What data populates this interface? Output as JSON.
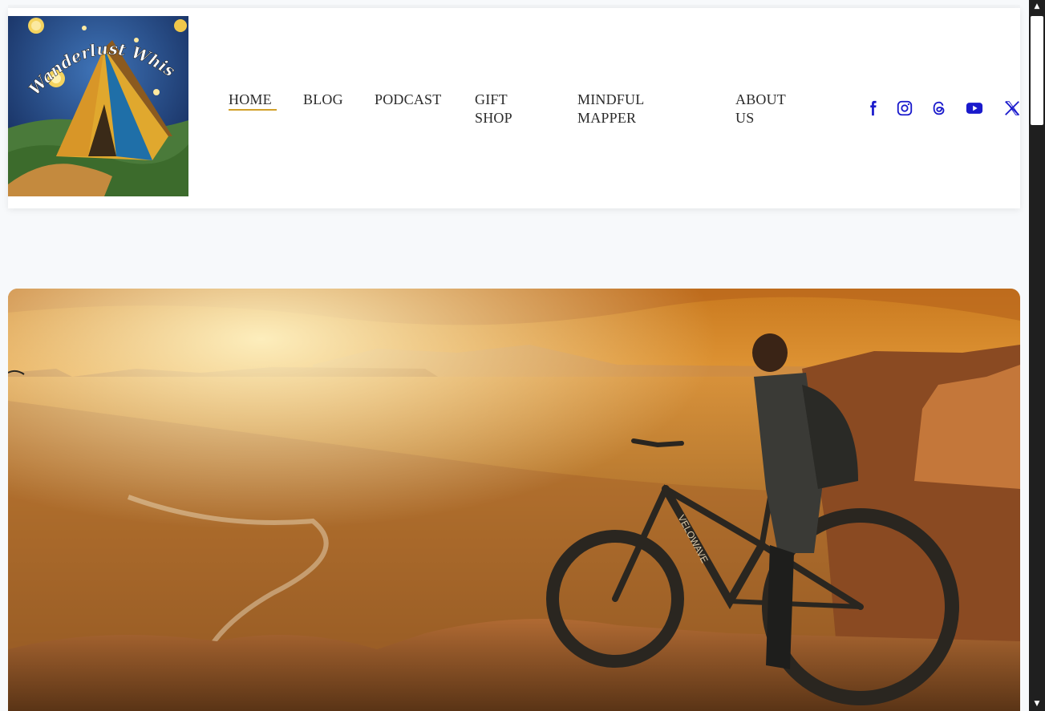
{
  "logo": {
    "text": "Wanderlust Whispers"
  },
  "nav": {
    "items": [
      {
        "label": "HOME",
        "active": true
      },
      {
        "label": "BLOG",
        "active": false
      },
      {
        "label": "PODCAST",
        "active": false
      },
      {
        "label": "GIFT SHOP",
        "active": false
      },
      {
        "label": "MINDFUL MAPPER",
        "active": false
      },
      {
        "label": "ABOUT US",
        "active": false
      }
    ]
  },
  "social": {
    "icons": [
      "facebook-icon",
      "instagram-icon",
      "threads-icon",
      "youtube-icon",
      "x-icon"
    ],
    "color": "#1a1acc"
  },
  "hero": {
    "bike_brand": "VELOWAVE"
  },
  "colors": {
    "accent": "#d1a02a",
    "nav_text": "#2b2b2b",
    "page_bg": "#f7f9fb"
  }
}
